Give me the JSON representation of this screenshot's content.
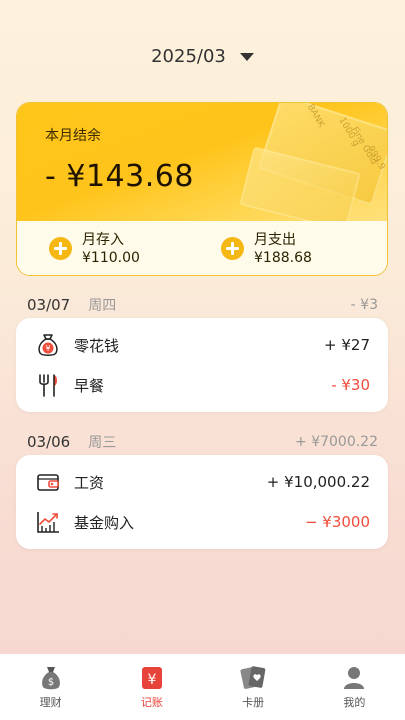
{
  "header": {
    "month": "2025/03"
  },
  "summary": {
    "title": "本月结余",
    "balance": "- ¥143.68",
    "deposit_label": "月存入",
    "deposit_value": "¥110.00",
    "expense_label": "月支出",
    "expense_value": "¥188.68",
    "decoration_text": [
      "1000 g",
      "Fine Gold",
      "999.9",
      "BANK"
    ]
  },
  "days": [
    {
      "date": "03/07",
      "weekday": "周四",
      "total": "- ¥3",
      "entries": [
        {
          "icon": "money-bag-icon",
          "name": "零花钱",
          "amount": "+ ¥27",
          "type": "income"
        },
        {
          "icon": "fork-knife-icon",
          "name": "早餐",
          "amount": "- ¥30",
          "type": "expense"
        }
      ]
    },
    {
      "date": "03/06",
      "weekday": "周三",
      "total": "+ ¥7000.22",
      "entries": [
        {
          "icon": "wallet-icon",
          "name": "工资",
          "amount": "+ ¥10,000.22",
          "type": "income"
        },
        {
          "icon": "chart-up-icon",
          "name": "基金购入",
          "amount": "− ¥3000",
          "type": "expense"
        }
      ]
    }
  ],
  "tabs": [
    {
      "label": "理财",
      "icon": "money-bag-icon",
      "active": false
    },
    {
      "label": "记账",
      "icon": "yen-ledger-icon",
      "active": true
    },
    {
      "label": "卡册",
      "icon": "cards-icon",
      "active": false
    },
    {
      "label": "我的",
      "icon": "user-icon",
      "active": false
    }
  ],
  "colors": {
    "accent": "#FFC61A",
    "expense": "#F04C3A",
    "active_tab": "#E8433A"
  }
}
